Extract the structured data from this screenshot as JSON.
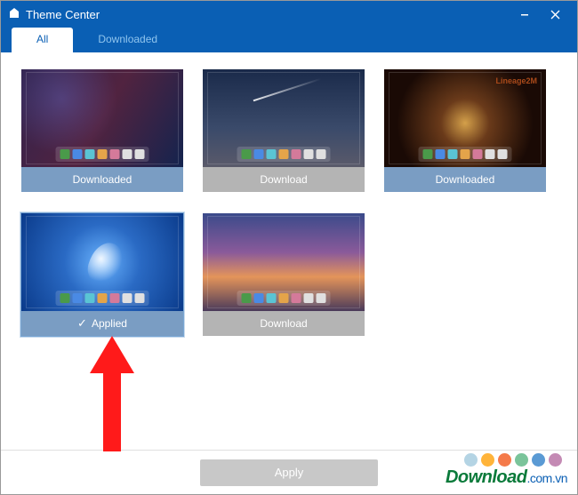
{
  "window": {
    "title": "Theme Center"
  },
  "tabs": {
    "all": "All",
    "downloaded": "Downloaded"
  },
  "themes": [
    {
      "status": "Downloaded",
      "status_type": "downloaded",
      "bg": "bg1",
      "logo": ""
    },
    {
      "status": "Download",
      "status_type": "download",
      "bg": "bg2",
      "logo": ""
    },
    {
      "status": "Downloaded",
      "status_type": "downloaded",
      "bg": "bg3",
      "logo": "Lineage2M"
    },
    {
      "status": "Applied",
      "status_type": "applied",
      "bg": "bg4",
      "logo": "",
      "selected": true,
      "check": true
    },
    {
      "status": "Download",
      "status_type": "download",
      "bg": "bg5",
      "logo": ""
    }
  ],
  "footer": {
    "apply": "Apply"
  },
  "watermark": {
    "brand": "Download",
    "domain": ".com.vn"
  },
  "dock_colors": [
    "#4a9a4a",
    "#4a8ae4",
    "#5ac4d4",
    "#e4a44a",
    "#d47a9a",
    "#e0e0e0",
    "#e0e0e0"
  ],
  "dot_colors": [
    "#b4d4e4",
    "#ffb43a",
    "#f47a4a",
    "#7ac49a",
    "#5a9ad4",
    "#c48ab4"
  ]
}
